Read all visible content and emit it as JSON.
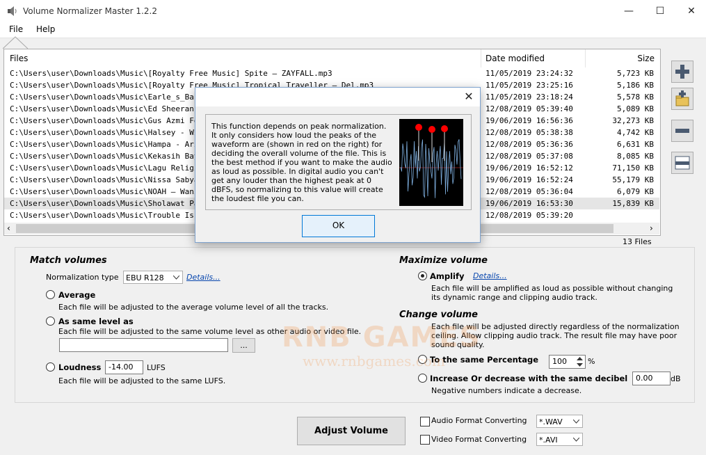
{
  "window": {
    "title": "Volume Normalizer Master 1.2.2",
    "minimize": "—",
    "maximize": "☐",
    "close": "✕"
  },
  "menu": [
    "File",
    "Help"
  ],
  "file_list": {
    "columns": [
      "Files",
      "Date modified",
      "Size"
    ],
    "rows": [
      {
        "file": "C:\\Users\\user\\Downloads\\Music\\[Royalty Free Music] Spite — ZAYFALL.mp3",
        "date": "11/05/2019 23:24:32",
        "size": "5,723 KB"
      },
      {
        "file": "C:\\Users\\user\\Downloads\\Music\\[Royalty Free Music] Tropical Traveller — Del.mp3",
        "date": "11/05/2019 23:25:16",
        "size": "5,186 KB"
      },
      {
        "file": "C:\\Users\\user\\Downloads\\Music\\Earle_s_Bar_I",
        "date": "11/05/2019 23:18:24",
        "size": "5,578 KB"
      },
      {
        "file": "C:\\Users\\user\\Downloads\\Music\\Ed Sheeran  J",
        "date": "12/08/2019 05:39:40",
        "size": "5,089 KB"
      },
      {
        "file": "C:\\Users\\user\\Downloads\\Music\\Gus Azmi Fea",
        "date": "19/06/2019 16:56:36",
        "size": "32,273 KB"
      },
      {
        "file": "C:\\Users\\user\\Downloads\\Music\\Halsey - With",
        "date": "12/08/2019 05:38:38",
        "size": "4,742 KB"
      },
      {
        "file": "C:\\Users\\user\\Downloads\\Music\\Hampa - Ari L",
        "date": "12/08/2019 05:36:36",
        "size": "6,631 KB"
      },
      {
        "file": "C:\\Users\\user\\Downloads\\Music\\Kekasih Baya",
        "date": "12/08/2019 05:37:08",
        "size": "8,085 KB"
      },
      {
        "file": "C:\\Users\\user\\Downloads\\Music\\Lagu Religi Us",
        "date": "19/06/2019 16:52:12",
        "size": "71,150 KB"
      },
      {
        "file": "C:\\Users\\user\\Downloads\\Music\\Nissa Sabyan",
        "date": "19/06/2019 16:52:24",
        "size": "55,179 KB"
      },
      {
        "file": "C:\\Users\\user\\Downloads\\Music\\NOAH – Wanit",
        "date": "12/08/2019 05:36:04",
        "size": "6,079 KB"
      },
      {
        "file": "C:\\Users\\user\\Downloads\\Music\\Sholawat Pali",
        "date": "19/06/2019 16:53:30",
        "size": "15,839 KB"
      },
      {
        "file": "C:\\Users\\user\\Downloads\\Music\\Trouble Is A F",
        "date": "12/08/2019 05:39:20",
        "size": ""
      }
    ],
    "count": "13 Files",
    "scroll_left": "‹",
    "scroll_right": "›"
  },
  "match_volumes": {
    "heading": "Match volumes",
    "norm_type_label": "Normalization type",
    "norm_type_value": "EBU R128",
    "details_link": "Details...",
    "average_label": "Average",
    "average_desc": "Each file will be adjusted to the average volume level of all the tracks.",
    "same_level_label": "As same level as",
    "same_level_desc": "Each file will be adjusted to the same volume level as other audio or video file.",
    "browse_label": "...",
    "loudness_label": "Loudness",
    "loudness_value": "-14.00",
    "loudness_unit": "LUFS",
    "loudness_desc": "Each file will be adjusted to the same LUFS."
  },
  "maximize_volume": {
    "heading": "Maximize volume",
    "amplify_label": "Amplify",
    "details_link": "Details...",
    "amplify_desc_1": "Each file will be amplified as loud as possible without changing",
    "amplify_desc_2": "its dynamic range and clipping audio track."
  },
  "change_volume": {
    "heading": "Change volume",
    "desc_1": "Each file will be adjusted directly regardless of the normalization",
    "desc_2": "ceiling. Allow clipping audio track. The result file may have poor",
    "desc_3": "sound quality.",
    "percentage_label": "To the same Percentage",
    "percentage_value": "100",
    "percentage_unit": "%",
    "decibel_label": "Increase Or decrease with the same decibel",
    "decibel_value": "0.00",
    "decibel_unit": "dB",
    "negative_note": "Negative numbers indicate a decrease."
  },
  "actions": {
    "adjust_label": "Adjust Volume",
    "audio_format_label": "Audio Format Converting",
    "audio_format_value": "*.WAV",
    "video_format_label": "Video Format Converting",
    "video_format_value": "*.AVI"
  },
  "dialog": {
    "close": "✕",
    "text": "This function depends on peak normalization. It only considers how loud the peaks of the waveform are (shown in red on the right) for deciding the overall volume of the file. This is the best method if you want to make the audio as loud as possible. In digital audio you can't get any louder than the highest peak at 0 dBFS, so normalizing to this value will create the loudest file you can.",
    "ok_label": "OK"
  },
  "watermark": {
    "line1": "RNB GAMES",
    "line2": "www.rnbgames.com"
  },
  "colors": {
    "accent": "#0078d7",
    "link": "#0645ad",
    "peak_red": "#ff0000",
    "wave_blue": "#7fb0e0"
  }
}
